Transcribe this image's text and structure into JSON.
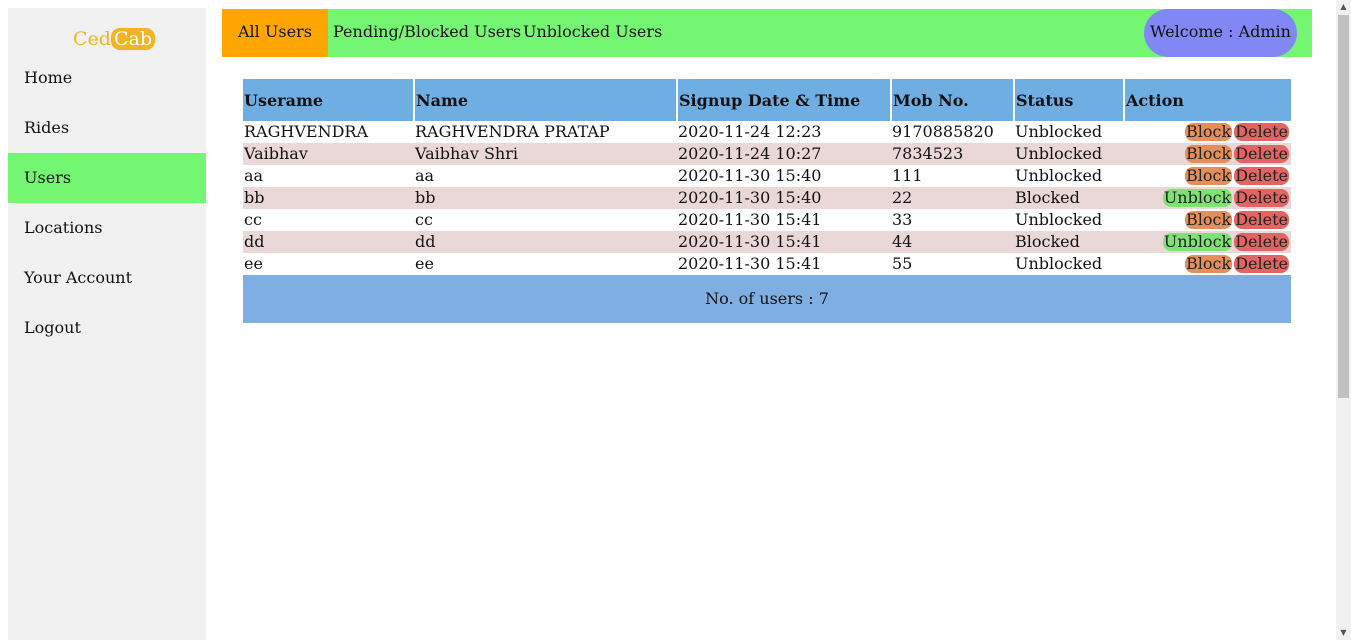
{
  "sidebar": {
    "logo": {
      "part1": "Ced",
      "part2": "Cab"
    },
    "items": [
      {
        "label": "Home"
      },
      {
        "label": "Rides"
      },
      {
        "label": "Users"
      },
      {
        "label": "Locations"
      },
      {
        "label": "Your Account"
      },
      {
        "label": "Logout"
      }
    ],
    "active": "Users"
  },
  "topbar": {
    "tabs": [
      {
        "label": "All Users"
      },
      {
        "label": "Pending/Blocked Users"
      },
      {
        "label": "Unblocked Users"
      }
    ],
    "active_tab": "All Users",
    "welcome": "Welcome : Admin"
  },
  "table": {
    "headers": [
      "Userame",
      "Name",
      "Signup Date & Time",
      "Mob No.",
      "Status",
      "Action"
    ],
    "rows": [
      {
        "username": "RAGHVENDRA",
        "name": "RAGHVENDRA PRATAP",
        "signup": "2020-11-24 12:23",
        "mobile": "9170885820",
        "status": "Unblocked",
        "toggle_label": "Block",
        "delete_label": "Delete"
      },
      {
        "username": "Vaibhav",
        "name": "Vaibhav Shri",
        "signup": "2020-11-24 10:27",
        "mobile": "7834523",
        "status": "Unblocked",
        "toggle_label": "Block",
        "delete_label": "Delete"
      },
      {
        "username": "aa",
        "name": "aa",
        "signup": "2020-11-30 15:40",
        "mobile": "111",
        "status": "Unblocked",
        "toggle_label": "Block",
        "delete_label": "Delete"
      },
      {
        "username": "bb",
        "name": "bb",
        "signup": "2020-11-30 15:40",
        "mobile": "22",
        "status": "Blocked",
        "toggle_label": "Unblock",
        "delete_label": "Delete"
      },
      {
        "username": "cc",
        "name": "cc",
        "signup": "2020-11-30 15:41",
        "mobile": "33",
        "status": "Unblocked",
        "toggle_label": "Block",
        "delete_label": "Delete"
      },
      {
        "username": "dd",
        "name": "dd",
        "signup": "2020-11-30 15:41",
        "mobile": "44",
        "status": "Blocked",
        "toggle_label": "Unblock",
        "delete_label": "Delete"
      },
      {
        "username": "ee",
        "name": "ee",
        "signup": "2020-11-30 15:41",
        "mobile": "55",
        "status": "Unblocked",
        "toggle_label": "Block",
        "delete_label": "Delete"
      }
    ],
    "footer": "No. of users : 7"
  },
  "colors": {
    "nav_active": "#74f672",
    "tab_active": "#ffa500",
    "welcome_pill": "#8187f4",
    "header_bg": "#6faee3",
    "row_alt": "#ead8d8",
    "block_btn": "#e68e57",
    "unblock_btn": "#7fe374",
    "delete_btn": "#e46464",
    "logo": "#f3b324"
  }
}
